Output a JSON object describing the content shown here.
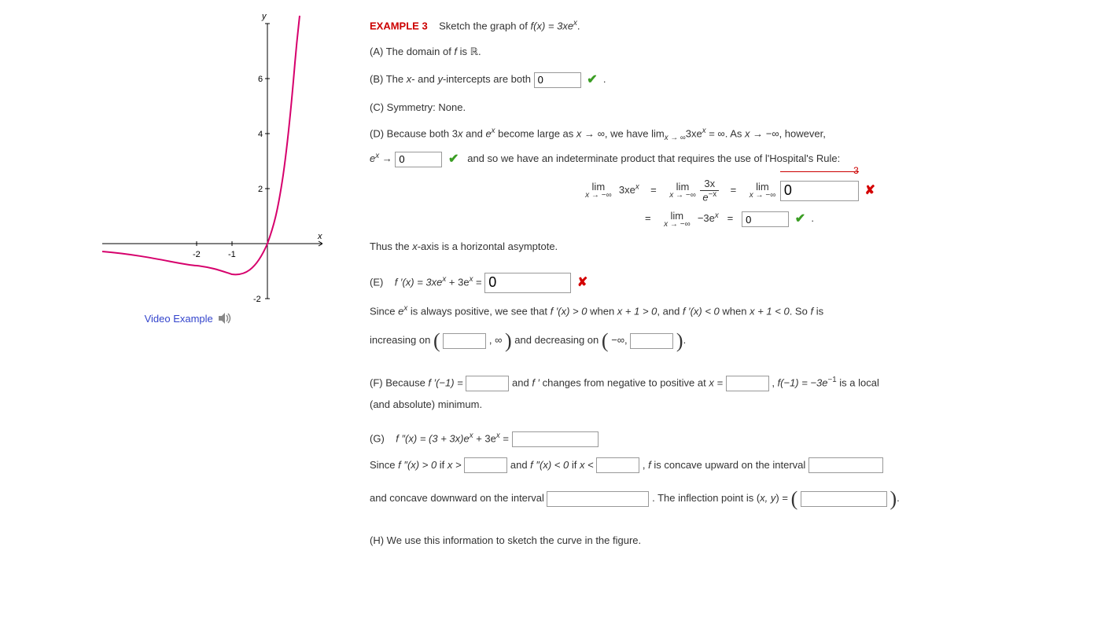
{
  "left": {
    "video_link": "Video Example",
    "speaker": "audio-icon"
  },
  "header": {
    "example_label": "EXAMPLE 3",
    "prompt_pre": "Sketch the graph of  ",
    "prompt_fx": "f(x) = 3xe",
    "prompt_sup": "x",
    "prompt_post": "."
  },
  "A": {
    "text_pre": "(A) The domain of ",
    "text_mid": "f",
    "text_post": " is ",
    "R": "ℝ",
    "dot": "."
  },
  "B": {
    "text_pre": "(B) The ",
    "x": "x",
    "text_mid": "- and ",
    "y": "y",
    "text_post": "-intercepts are both ",
    "val": "0",
    "dot": "."
  },
  "C": {
    "text": "(C) Symmetry: None."
  },
  "D": {
    "line1_a": "(D) Because both  3",
    "line1_x": "x",
    "line1_b": "  and  ",
    "line1_e": "e",
    "line1_c": "  become large as  ",
    "line1_lim": "x → ∞",
    "line1_d": ",  we have  lim",
    "line1_sub": "x → ∞",
    "line1_e2": "3xe",
    "line1_f": " = ∞.  As  ",
    "line1_g": "x → −∞",
    "line1_h": ",  however,",
    "line2_a": "e",
    "line2_arrow": " → ",
    "line2_val": "0",
    "line2_b": "and so we have an indeterminate product that requires the use of l'Hospital's Rule:",
    "score3": "3",
    "lim_top": "lim",
    "lim_bot": "x → −∞",
    "term1": "3xe",
    "eq": " = ",
    "frac_num": "3x",
    "frac_den_e": "e",
    "frac_den_sup": "−x",
    "ans3_val": "0",
    "term4": "−3e",
    "ans4_val": "0",
    "dot": ".",
    "thus": "Thus the ",
    "thus_x": "x",
    "thus_b": "-axis is a horizontal asymptote."
  },
  "E": {
    "label": "(E)",
    "body_a": "f ′(x) = 3xe",
    "body_b": " + 3e",
    "eq": " = ",
    "ans_val": "0",
    "since_a": "Since  ",
    "since_e": "e",
    "since_b": "  is always positive, we see that  ",
    "since_c": "f ′(x) > 0",
    "since_d": "  when  ",
    "since_cond1": "x + 1 > 0",
    "since_e2": ",  and  ",
    "since_f": "f ′(x) < 0",
    "since_g": "  when  ",
    "since_cond2": "x + 1 < 0",
    "since_h": ".  So ",
    "since_f2": "f",
    "since_i": " is",
    "inc_a": "increasing on  ",
    "inc_inf": ", ∞",
    "dec_a": "  and decreasing on  ",
    "dec_inf": "−∞, ",
    "dot": "."
  },
  "F": {
    "a": "(F) Because  ",
    "b": "f ′(−1) = ",
    "c": "  and  ",
    "d": "f ′",
    "e": "  changes from negative to positive at  ",
    "xeq": "x = ",
    "f": ",    ",
    "g": "f(−1) = −3e",
    "sup": "−1",
    "h": "  is a local",
    "i": "(and absolute) minimum."
  },
  "G": {
    "label": "(G)",
    "a": "f ″(x) = (3 + 3x)e",
    "b": " + 3e",
    "eq": " = ",
    "sin_a": "Since  ",
    "sin_b": "f ″(x) > 0",
    "sin_c": "  if  ",
    "sin_d": "x > ",
    "sin_e": "  and  ",
    "sin_f": "f ″(x) < 0",
    "sin_g": "  if  ",
    "sin_h": "x < ",
    "sin_i": ",  ",
    "sin_f2": "f",
    "sin_j": " is concave upward on the interval ",
    "cd_a": "and concave downward on the interval ",
    "cd_b": ". The inflection point is  (",
    "cd_xy": "x, y",
    "cd_c": ") = ",
    "dot": "."
  },
  "H": {
    "text": "(H) We use this information to sketch the curve in the figure."
  },
  "chart_data": {
    "type": "line",
    "title": "",
    "xlabel": "x",
    "ylabel": "y",
    "xlim": [
      -2.5,
      1.1
    ],
    "ylim": [
      -2,
      6
    ],
    "xticks": [
      -2,
      -1
    ],
    "yticks": [
      -2,
      2,
      4,
      6
    ],
    "series": [
      {
        "name": "f(x)=3x e^x",
        "color": "#d6006c",
        "x": [
          -2.5,
          -2.0,
          -1.5,
          -1.0,
          -0.5,
          0.0,
          0.25,
          0.5,
          0.75,
          1.0
        ],
        "y": [
          -0.62,
          -0.81,
          -1.0,
          -1.1,
          -0.91,
          0.0,
          0.96,
          2.47,
          4.76,
          8.15
        ]
      }
    ]
  }
}
